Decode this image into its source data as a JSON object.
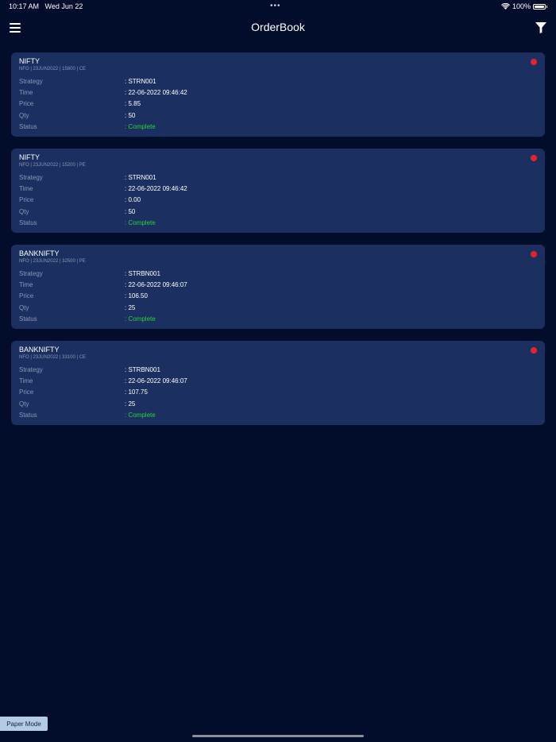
{
  "status_bar": {
    "time": "10:17 AM",
    "date": "Wed Jun 22",
    "dots": "•••",
    "battery_percent": "100%",
    "battery_level": 1.0
  },
  "nav": {
    "title": "OrderBook",
    "menu_icon": "hamburger-menu-icon",
    "filter_icon": "filter-funnel-icon"
  },
  "field_labels": {
    "strategy": "Strategy",
    "time": "Time",
    "price": "Price",
    "qty": "Qty",
    "status": "Status"
  },
  "orders": [
    {
      "symbol": "NIFTY",
      "subtitle": "NFO | 23JUN2022 | 15800 | CE",
      "strategy": ": STRN001",
      "time": ": 22-06-2022 09:46:42",
      "price": ": 5.85",
      "qty": ": 50",
      "status": ": Complete"
    },
    {
      "symbol": "NIFTY",
      "subtitle": "NFO | 23JUN2022 | 15200 | PE",
      "strategy": ": STRN001",
      "time": ": 22-06-2022 09:46:42",
      "price": ": 0.00",
      "qty": ": 50",
      "status": ": Complete"
    },
    {
      "symbol": "BANKNIFTY",
      "subtitle": "NFO | 23JUN2022 | 32500 | PE",
      "strategy": ": STRBN001",
      "time": ": 22-06-2022 09:46:07",
      "price": ": 106.50",
      "qty": ": 25",
      "status": ": Complete"
    },
    {
      "symbol": "BANKNIFTY",
      "subtitle": "NFO | 23JUN2022 | 33100 | CE",
      "strategy": ": STRBN001",
      "time": ": 22-06-2022 09:46:07",
      "price": ": 107.75",
      "qty": ": 25",
      "status": ": Complete"
    }
  ],
  "paper_mode_label": "Paper Mode",
  "colors": {
    "background": "#020c2b",
    "card": "#1b3060",
    "status_complete": "#2ad13a",
    "status_dot": "#e3242b",
    "label": "#8b97b4",
    "paper_mode_bg": "#b3cbe4"
  }
}
